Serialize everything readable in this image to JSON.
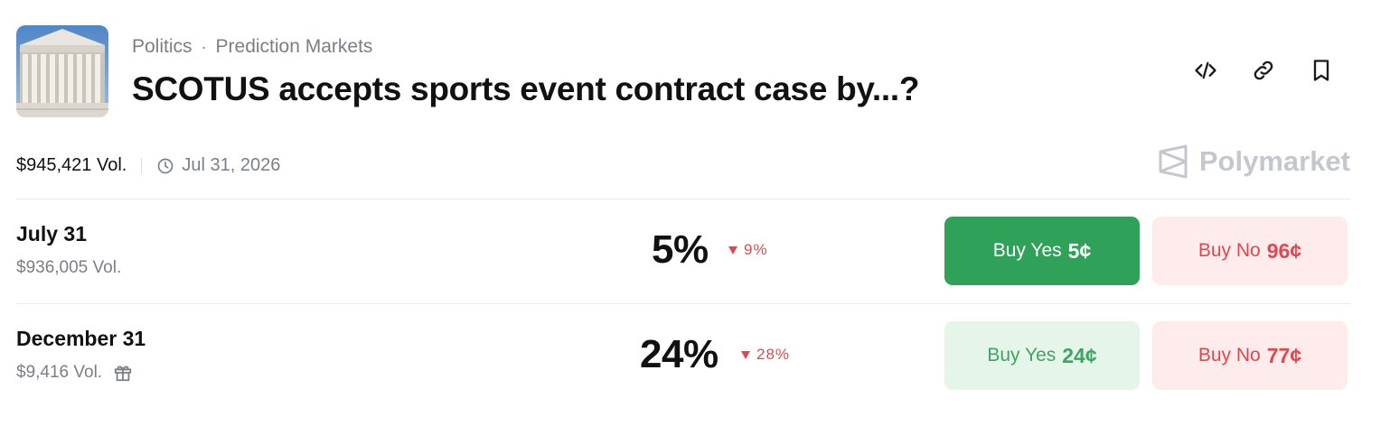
{
  "header": {
    "breadcrumb": [
      "Politics",
      "Prediction Markets"
    ],
    "separator": "·",
    "title": "SCOTUS accepts sports event contract case by...?"
  },
  "actions": [
    "embed-code-icon",
    "link-icon",
    "bookmark-icon"
  ],
  "meta": {
    "volume": "$945,421 Vol.",
    "end_date": "Jul 31, 2026"
  },
  "brand": "Polymarket",
  "outcomes": [
    {
      "label": "July 31",
      "volume": "$936,005 Vol.",
      "probability": "5%",
      "change": "9%",
      "change_direction": "down",
      "yes_label": "Buy Yes",
      "yes_price": "5¢",
      "no_label": "Buy No",
      "no_price": "96¢"
    },
    {
      "label": "December 31",
      "volume": "$9,416 Vol.",
      "probability": "24%",
      "change": "28%",
      "change_direction": "down",
      "yes_label": "Buy Yes",
      "yes_price": "24¢",
      "no_label": "Buy No",
      "no_price": "77¢"
    }
  ],
  "colors": {
    "yes_active": "#30a159",
    "yes_soft_bg": "#e6f5ea",
    "no_soft_bg": "#fdeceb",
    "down": "#e0484f"
  }
}
